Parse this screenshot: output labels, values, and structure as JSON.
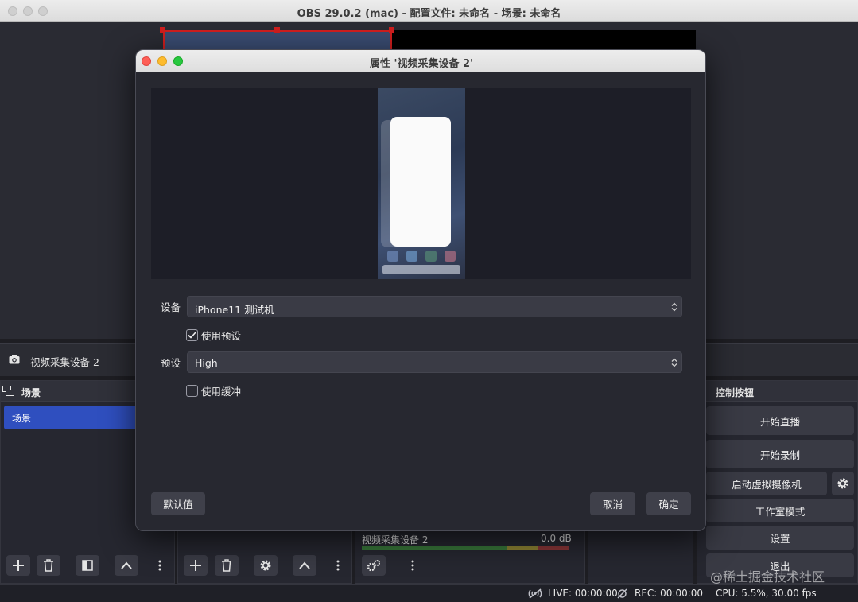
{
  "window": {
    "title": "OBS 29.0.2 (mac) - 配置文件: 未命名 - 场景: 未命名"
  },
  "source_bar": {
    "name": "视频采集设备 2"
  },
  "scenes_dock": {
    "title": "场景",
    "items": [
      {
        "label": "场景"
      }
    ]
  },
  "mixer": {
    "source_name": "视频采集设备 2",
    "level": "0.0 dB"
  },
  "controls_dock": {
    "title": "控制按钮",
    "start_streaming": "开始直播",
    "start_recording": "开始录制",
    "start_virtual_camera": "启动虚拟摄像机",
    "studio_mode": "工作室模式",
    "settings": "设置",
    "exit": "退出"
  },
  "status": {
    "live": "LIVE: 00:00:00",
    "rec": "REC: 00:00:00",
    "cpu": "CPU: 5.5%, 30.00 fps"
  },
  "dialog": {
    "title": "属性 '视频采集设备 2'",
    "device_label": "设备",
    "device_value": "iPhone11 测试机",
    "use_preset_label": "使用预设",
    "use_preset_checked": true,
    "preset_label": "预设",
    "preset_value": "High",
    "use_buffer_label": "使用缓冲",
    "use_buffer_checked": false,
    "defaults_button": "默认值",
    "cancel_button": "取消",
    "ok_button": "确定"
  },
  "watermark": "@稀土掘金技术社区",
  "colors": {
    "accent": "#2f4fbf",
    "selection_red": "#d01e1e",
    "background": "#1e1e23"
  }
}
